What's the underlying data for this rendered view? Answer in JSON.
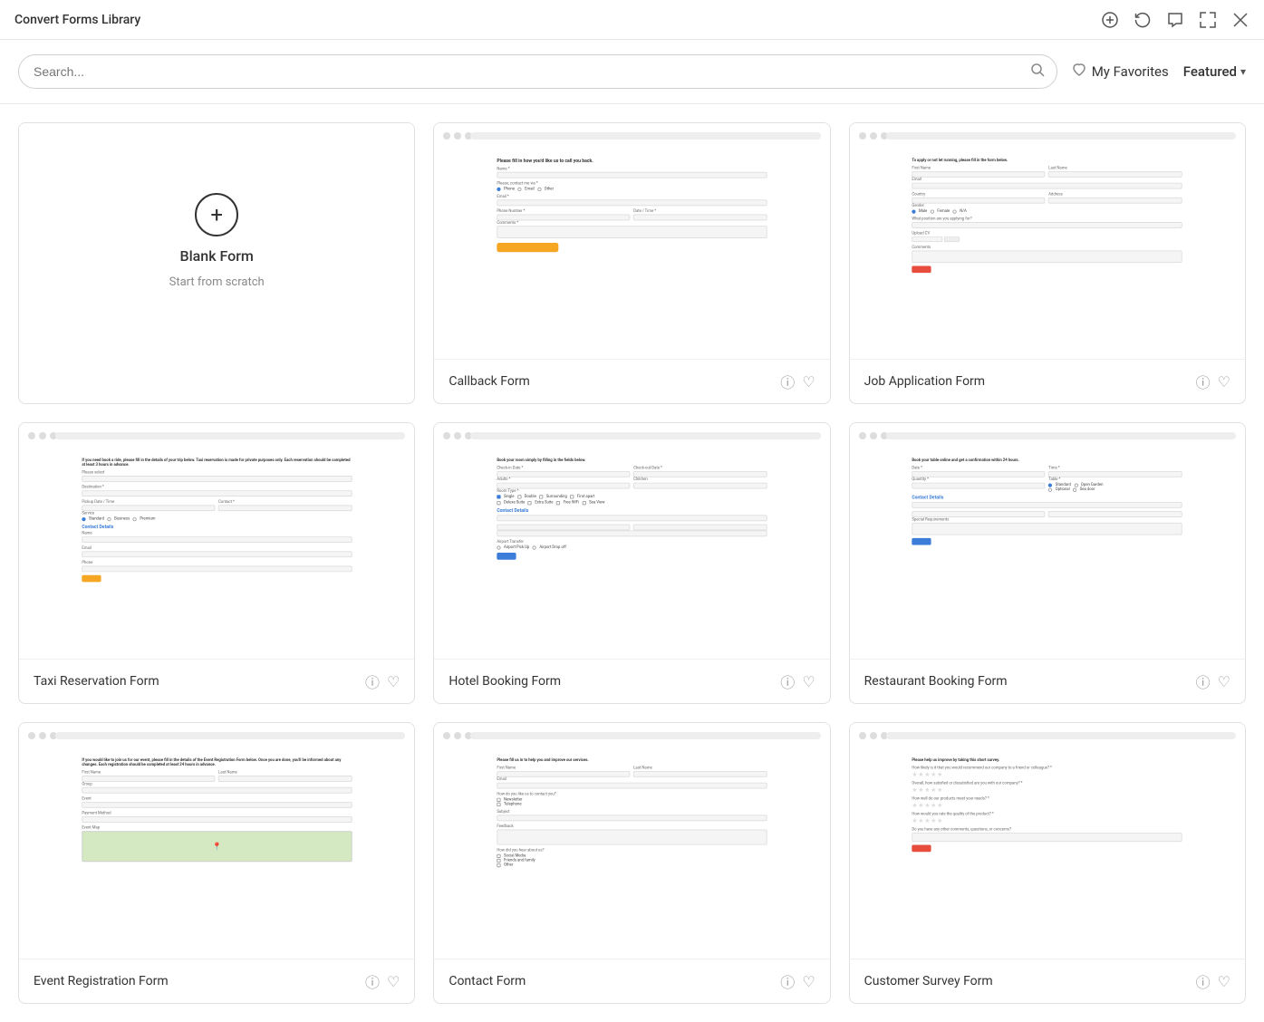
{
  "titleBar": {
    "title": "Convert Forms Library",
    "icons": [
      "plus-icon",
      "refresh-icon",
      "chat-icon",
      "expand-icon",
      "close-icon"
    ]
  },
  "header": {
    "search": {
      "placeholder": "Search...",
      "value": ""
    },
    "myFavorites": "My Favorites",
    "featured": "Featured"
  },
  "cards": [
    {
      "id": "blank",
      "title": "Blank Form",
      "subtitle": "Start from scratch",
      "type": "blank"
    },
    {
      "id": "callback",
      "title": "Callback Form",
      "type": "callback"
    },
    {
      "id": "job-application",
      "title": "Job Application Form",
      "type": "job-application"
    },
    {
      "id": "taxi-reservation",
      "title": "Taxi Reservation Form",
      "type": "taxi"
    },
    {
      "id": "hotel-booking",
      "title": "Hotel Booking Form",
      "type": "hotel"
    },
    {
      "id": "restaurant-booking",
      "title": "Restaurant Booking Form",
      "type": "restaurant"
    },
    {
      "id": "form7",
      "title": "Event Registration Form",
      "type": "event"
    },
    {
      "id": "form8",
      "title": "Contact Form",
      "type": "contact"
    },
    {
      "id": "form9",
      "title": "Customer Survey Form",
      "type": "survey"
    }
  ]
}
